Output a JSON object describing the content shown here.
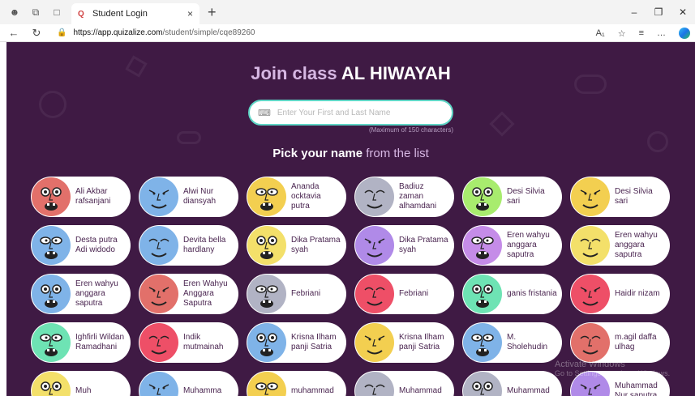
{
  "browser": {
    "tab_title": "Student Login",
    "tab_close": "×",
    "new_tab": "+",
    "url_host": "https://app.quizalize.com",
    "url_path": "/student/simple/cqe89260",
    "win_min": "–",
    "win_restore": "❐",
    "win_close": "✕"
  },
  "page": {
    "join_prefix": "Join class",
    "class_name": "AL HIWAYAH",
    "name_placeholder": "Enter Your First and Last Name",
    "max_chars": "(Maximum of 150 characters)",
    "pick_strong": "Pick your name",
    "pick_soft": "from the list"
  },
  "students": [
    {
      "name": "Ali Akbar rafsanjani",
      "color": "#e2706a"
    },
    {
      "name": "Alwi Nur diansyah",
      "color": "#7fb3e8"
    },
    {
      "name": "Ananda ocktavia putra",
      "color": "#f3cf50"
    },
    {
      "name": "Badiuz zaman alhamdani",
      "color": "#b1b3c4"
    },
    {
      "name": "Desi Silvia sari",
      "color": "#a8ec6e"
    },
    {
      "name": "Desi Silvia sari",
      "color": "#f3cf50"
    },
    {
      "name": "Desta putra Adi widodo",
      "color": "#7fb3e8"
    },
    {
      "name": "Devita bella hardlany",
      "color": "#7fb3e8"
    },
    {
      "name": "Dika Pratama syah",
      "color": "#f3e06a"
    },
    {
      "name": "Dika Pratama syah",
      "color": "#b08ae8"
    },
    {
      "name": "Eren wahyu anggara saputra",
      "color": "#c58ce8"
    },
    {
      "name": "Eren wahyu anggara saputra",
      "color": "#f3e06a"
    },
    {
      "name": "Eren wahyu anggara saputra",
      "color": "#7fb3e8"
    },
    {
      "name": "Eren Wahyu Anggara Saputra",
      "color": "#e2706a"
    },
    {
      "name": "Febriani",
      "color": "#b1b3c4"
    },
    {
      "name": "Febriani",
      "color": "#ee4f67"
    },
    {
      "name": "ganis fristania",
      "color": "#6ee3b4"
    },
    {
      "name": "Haidir nizam",
      "color": "#ee4f67"
    },
    {
      "name": "Ighfirli Wildan Ramadhani",
      "color": "#6ee3b4"
    },
    {
      "name": "Indik mutmainah",
      "color": "#ee4f67"
    },
    {
      "name": "Krisna Ilham panji Satria",
      "color": "#7fb3e8"
    },
    {
      "name": "Krisna Ilham panji Satria",
      "color": "#f3cf50"
    },
    {
      "name": "M. Sholehudin",
      "color": "#7fb3e8"
    },
    {
      "name": "m.agil daffa ulhag",
      "color": "#e2706a"
    },
    {
      "name": "Muh",
      "color": "#f3e06a"
    },
    {
      "name": "Muhamma",
      "color": "#7fb3e8"
    },
    {
      "name": "muhammad",
      "color": "#f3cf50"
    },
    {
      "name": "Muhammad",
      "color": "#b1b3c4"
    },
    {
      "name": "Muhammad",
      "color": "#b1b3c4"
    },
    {
      "name": "Muhammad Nur saputra",
      "color": "#b08ae8"
    }
  ],
  "watermark": {
    "title": "Activate Windows",
    "sub": "Go to Settings to activate Windows."
  }
}
